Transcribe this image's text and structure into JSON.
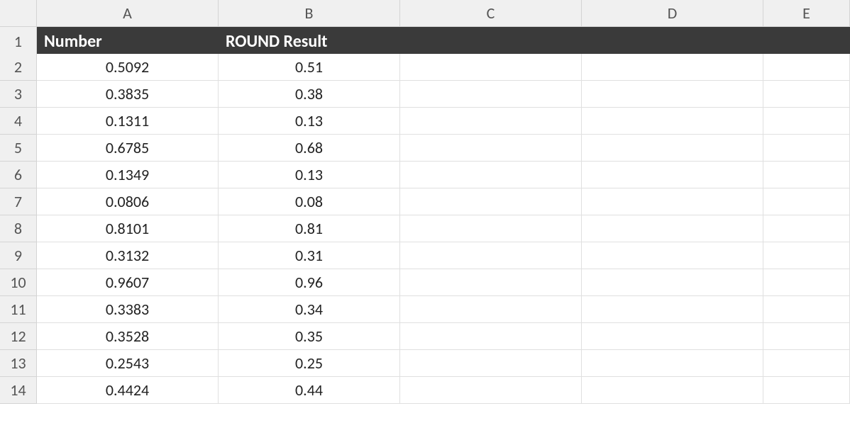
{
  "columns": [
    "A",
    "B",
    "C",
    "D",
    "E"
  ],
  "row_numbers": [
    1,
    2,
    3,
    4,
    5,
    6,
    7,
    8,
    9,
    10,
    11,
    12,
    13,
    14
  ],
  "header_row": {
    "A": "Number",
    "B": "ROUND Result",
    "C": "",
    "D": "",
    "E": ""
  },
  "data_rows": [
    {
      "A": "0.5092",
      "B": "0.51"
    },
    {
      "A": "0.3835",
      "B": "0.38"
    },
    {
      "A": "0.1311",
      "B": "0.13"
    },
    {
      "A": "0.6785",
      "B": "0.68"
    },
    {
      "A": "0.1349",
      "B": "0.13"
    },
    {
      "A": "0.0806",
      "B": "0.08"
    },
    {
      "A": "0.8101",
      "B": "0.81"
    },
    {
      "A": "0.3132",
      "B": "0.31"
    },
    {
      "A": "0.9607",
      "B": "0.96"
    },
    {
      "A": "0.3383",
      "B": "0.34"
    },
    {
      "A": "0.3528",
      "B": "0.35"
    },
    {
      "A": "0.2543",
      "B": "0.25"
    },
    {
      "A": "0.4424",
      "B": "0.44"
    }
  ]
}
